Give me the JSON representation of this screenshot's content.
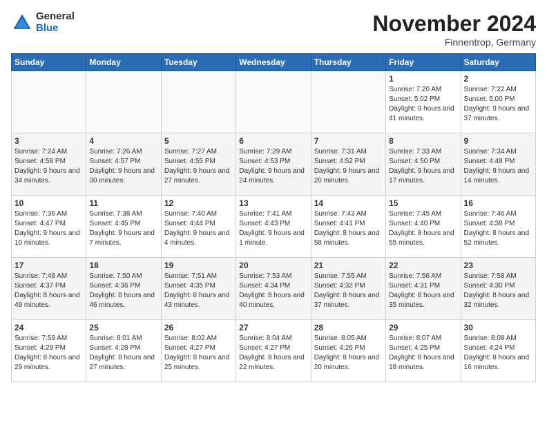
{
  "header": {
    "logo_general": "General",
    "logo_blue": "Blue",
    "title": "November 2024",
    "location": "Finnentrop, Germany"
  },
  "columns": [
    "Sunday",
    "Monday",
    "Tuesday",
    "Wednesday",
    "Thursday",
    "Friday",
    "Saturday"
  ],
  "weeks": [
    [
      {
        "day": "",
        "info": ""
      },
      {
        "day": "",
        "info": ""
      },
      {
        "day": "",
        "info": ""
      },
      {
        "day": "",
        "info": ""
      },
      {
        "day": "",
        "info": ""
      },
      {
        "day": "1",
        "info": "Sunrise: 7:20 AM\nSunset: 5:02 PM\nDaylight: 9 hours and 41 minutes."
      },
      {
        "day": "2",
        "info": "Sunrise: 7:22 AM\nSunset: 5:00 PM\nDaylight: 9 hours and 37 minutes."
      }
    ],
    [
      {
        "day": "3",
        "info": "Sunrise: 7:24 AM\nSunset: 4:58 PM\nDaylight: 9 hours and 34 minutes."
      },
      {
        "day": "4",
        "info": "Sunrise: 7:26 AM\nSunset: 4:57 PM\nDaylight: 9 hours and 30 minutes."
      },
      {
        "day": "5",
        "info": "Sunrise: 7:27 AM\nSunset: 4:55 PM\nDaylight: 9 hours and 27 minutes."
      },
      {
        "day": "6",
        "info": "Sunrise: 7:29 AM\nSunset: 4:53 PM\nDaylight: 9 hours and 24 minutes."
      },
      {
        "day": "7",
        "info": "Sunrise: 7:31 AM\nSunset: 4:52 PM\nDaylight: 9 hours and 20 minutes."
      },
      {
        "day": "8",
        "info": "Sunrise: 7:33 AM\nSunset: 4:50 PM\nDaylight: 9 hours and 17 minutes."
      },
      {
        "day": "9",
        "info": "Sunrise: 7:34 AM\nSunset: 4:48 PM\nDaylight: 9 hours and 14 minutes."
      }
    ],
    [
      {
        "day": "10",
        "info": "Sunrise: 7:36 AM\nSunset: 4:47 PM\nDaylight: 9 hours and 10 minutes."
      },
      {
        "day": "11",
        "info": "Sunrise: 7:38 AM\nSunset: 4:45 PM\nDaylight: 9 hours and 7 minutes."
      },
      {
        "day": "12",
        "info": "Sunrise: 7:40 AM\nSunset: 4:44 PM\nDaylight: 9 hours and 4 minutes."
      },
      {
        "day": "13",
        "info": "Sunrise: 7:41 AM\nSunset: 4:43 PM\nDaylight: 9 hours and 1 minute."
      },
      {
        "day": "14",
        "info": "Sunrise: 7:43 AM\nSunset: 4:41 PM\nDaylight: 8 hours and 58 minutes."
      },
      {
        "day": "15",
        "info": "Sunrise: 7:45 AM\nSunset: 4:40 PM\nDaylight: 8 hours and 55 minutes."
      },
      {
        "day": "16",
        "info": "Sunrise: 7:46 AM\nSunset: 4:38 PM\nDaylight: 8 hours and 52 minutes."
      }
    ],
    [
      {
        "day": "17",
        "info": "Sunrise: 7:48 AM\nSunset: 4:37 PM\nDaylight: 8 hours and 49 minutes."
      },
      {
        "day": "18",
        "info": "Sunrise: 7:50 AM\nSunset: 4:36 PM\nDaylight: 8 hours and 46 minutes."
      },
      {
        "day": "19",
        "info": "Sunrise: 7:51 AM\nSunset: 4:35 PM\nDaylight: 8 hours and 43 minutes."
      },
      {
        "day": "20",
        "info": "Sunrise: 7:53 AM\nSunset: 4:34 PM\nDaylight: 8 hours and 40 minutes."
      },
      {
        "day": "21",
        "info": "Sunrise: 7:55 AM\nSunset: 4:32 PM\nDaylight: 8 hours and 37 minutes."
      },
      {
        "day": "22",
        "info": "Sunrise: 7:56 AM\nSunset: 4:31 PM\nDaylight: 8 hours and 35 minutes."
      },
      {
        "day": "23",
        "info": "Sunrise: 7:58 AM\nSunset: 4:30 PM\nDaylight: 8 hours and 32 minutes."
      }
    ],
    [
      {
        "day": "24",
        "info": "Sunrise: 7:59 AM\nSunset: 4:29 PM\nDaylight: 8 hours and 29 minutes."
      },
      {
        "day": "25",
        "info": "Sunrise: 8:01 AM\nSunset: 4:28 PM\nDaylight: 8 hours and 27 minutes."
      },
      {
        "day": "26",
        "info": "Sunrise: 8:02 AM\nSunset: 4:27 PM\nDaylight: 8 hours and 25 minutes."
      },
      {
        "day": "27",
        "info": "Sunrise: 8:04 AM\nSunset: 4:27 PM\nDaylight: 8 hours and 22 minutes."
      },
      {
        "day": "28",
        "info": "Sunrise: 8:05 AM\nSunset: 4:26 PM\nDaylight: 8 hours and 20 minutes."
      },
      {
        "day": "29",
        "info": "Sunrise: 8:07 AM\nSunset: 4:25 PM\nDaylight: 8 hours and 18 minutes."
      },
      {
        "day": "30",
        "info": "Sunrise: 8:08 AM\nSunset: 4:24 PM\nDaylight: 8 hours and 16 minutes."
      }
    ]
  ]
}
